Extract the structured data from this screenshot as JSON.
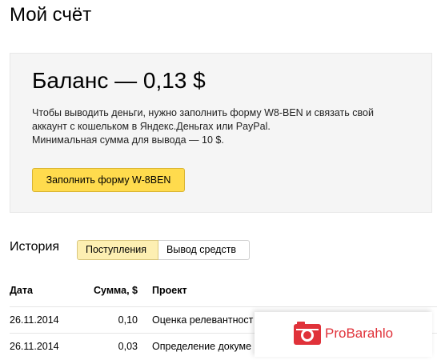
{
  "page": {
    "title": "Мой счёт"
  },
  "balance": {
    "title": "Баланс — 0,13 $",
    "description_lines": [
      "Чтобы выводить деньги, нужно заполнить форму W8-BEN и связать свой",
      "аккаунт с кошельком в Яндекс.Деньгах или PayPal.",
      "Минимальная сумма для вывода — 10 $."
    ],
    "button_label": "Заполнить форму W-8BEN",
    "button_color": "#ffdb4d"
  },
  "history": {
    "label": "История",
    "tabs": [
      {
        "label": "Поступления",
        "active": true
      },
      {
        "label": "Вывод средств",
        "active": false
      }
    ],
    "columns": [
      "Дата",
      "Сумма, $",
      "Проект"
    ],
    "rows": [
      {
        "date": "26.11.2014",
        "amount": "0,10",
        "project": "Оценка релевантност"
      },
      {
        "date": "26.11.2014",
        "amount": "0,03",
        "project": "Определение докуме"
      }
    ]
  },
  "watermark": {
    "text": "ProBarahlo",
    "icon": "camera-icon",
    "color": "#e0323a"
  }
}
